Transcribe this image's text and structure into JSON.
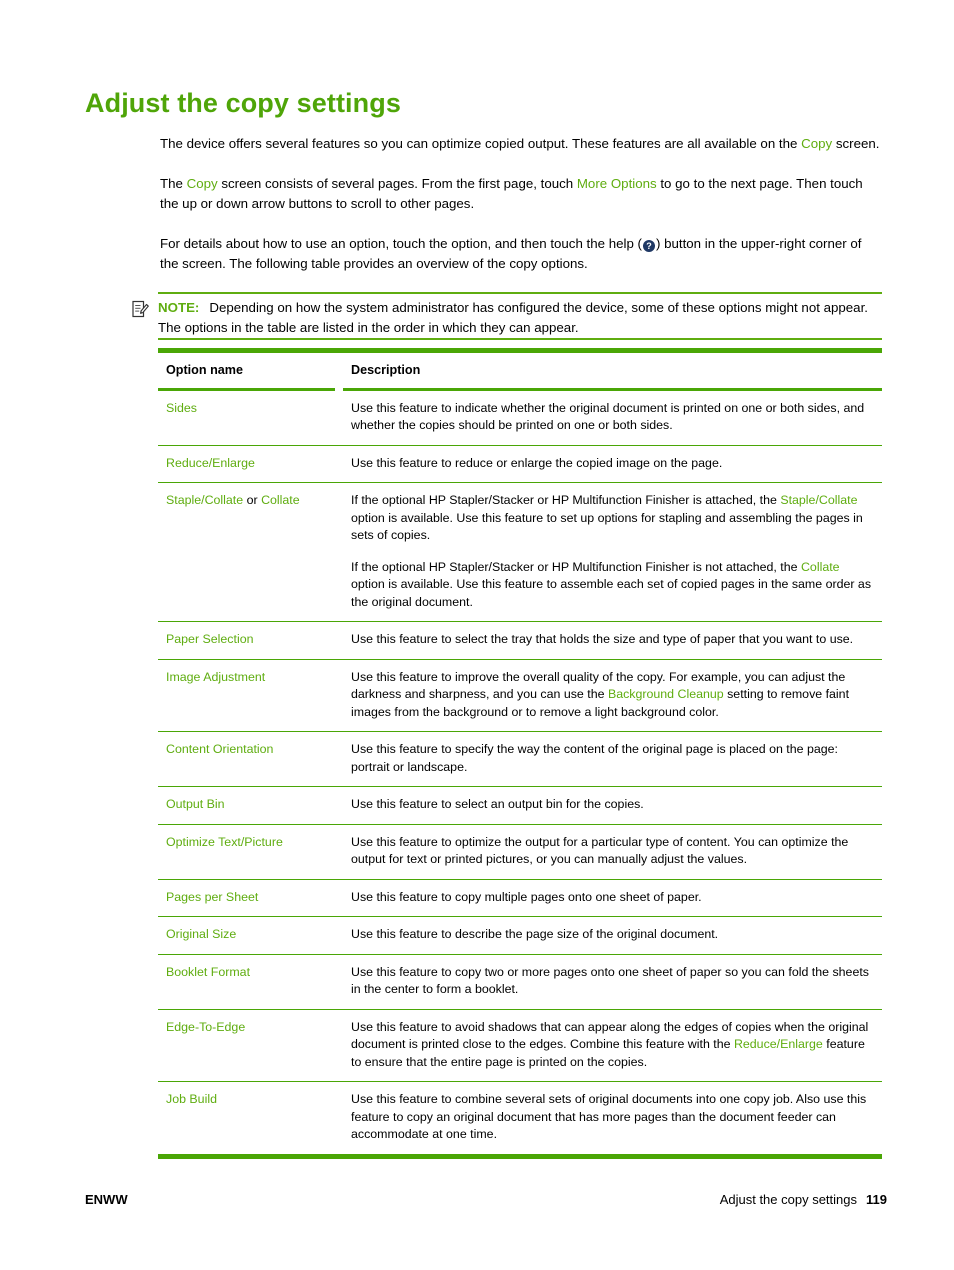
{
  "page": {
    "heading": "Adjust the copy settings",
    "accent_green": "#5FAD10",
    "rule_green": "#4AA606",
    "heading_green": "#4FA508",
    "help_icon_color": "#1F3864"
  },
  "intro": {
    "p1_a": "The device offers several features so you can optimize copied output. These features are all available on the ",
    "p1_link": "Copy",
    "p1_b": " screen.",
    "p2_a": "The ",
    "p2_link1": "Copy",
    "p2_b": " screen consists of several pages. From the first page, touch ",
    "p2_link2": "More Options",
    "p2_c": " to go to the next page. Then touch the up or down arrow buttons to scroll to other pages.",
    "p3_a": "For details about how to use an option, touch the option, and then touch the help (",
    "p3_icon": "?",
    "p3_b": ") button in the upper-right corner of the screen. The following table provides an overview of the copy options."
  },
  "note": {
    "label": "NOTE:",
    "text": "Depending on how the system administrator has configured the device, some of these options might not appear. The options in the table are listed in the order in which they can appear.",
    "icon": "note-pencil-icon"
  },
  "table": {
    "headers": {
      "col1": "Option name",
      "col2": "Description"
    },
    "rows": [
      {
        "name": "Sides",
        "name_parts": [
          {
            "t": "Sides",
            "link": true
          }
        ],
        "paragraphs": [
          [
            {
              "t": "Use this feature to indicate whether the original document is printed on one or both sides, and whether the copies should be printed on one or both sides.",
              "link": false
            }
          ]
        ]
      },
      {
        "name": "Reduce/Enlarge",
        "name_parts": [
          {
            "t": "Reduce/Enlarge",
            "link": true
          }
        ],
        "paragraphs": [
          [
            {
              "t": "Use this feature to reduce or enlarge the copied image on the page.",
              "link": false
            }
          ]
        ]
      },
      {
        "name": "Staple/Collate or Collate",
        "name_parts": [
          {
            "t": "Staple/Collate",
            "link": true
          },
          {
            "t": " or ",
            "link": false
          },
          {
            "t": "Collate",
            "link": true
          }
        ],
        "paragraphs": [
          [
            {
              "t": "If the optional HP Stapler/Stacker or HP Multifunction Finisher is attached, the ",
              "link": false
            },
            {
              "t": "Staple/Collate",
              "link": true
            },
            {
              "t": " option is available. Use this feature to set up options for stapling and assembling the pages in sets of copies.",
              "link": false
            }
          ],
          [
            {
              "t": "If the optional HP Stapler/Stacker or HP Multifunction Finisher is not attached, the ",
              "link": false
            },
            {
              "t": "Collate",
              "link": true
            },
            {
              "t": " option is available. Use this feature to assemble each set of copied pages in the same order as the original document.",
              "link": false
            }
          ]
        ]
      },
      {
        "name": "Paper Selection",
        "name_parts": [
          {
            "t": "Paper Selection",
            "link": true
          }
        ],
        "paragraphs": [
          [
            {
              "t": "Use this feature to select the tray that holds the size and type of paper that you want to use.",
              "link": false
            }
          ]
        ]
      },
      {
        "name": "Image Adjustment",
        "name_parts": [
          {
            "t": "Image Adjustment",
            "link": true
          }
        ],
        "paragraphs": [
          [
            {
              "t": "Use this feature to improve the overall quality of the copy. For example, you can adjust the darkness and sharpness, and you can use the ",
              "link": false
            },
            {
              "t": "Background Cleanup",
              "link": true
            },
            {
              "t": " setting to remove faint images from the background or to remove a light background color.",
              "link": false
            }
          ]
        ]
      },
      {
        "name": "Content Orientation",
        "name_parts": [
          {
            "t": "Content Orientation",
            "link": true
          }
        ],
        "paragraphs": [
          [
            {
              "t": "Use this feature to specify the way the content of the original page is placed on the page: portrait or landscape.",
              "link": false
            }
          ]
        ]
      },
      {
        "name": "Output Bin",
        "name_parts": [
          {
            "t": "Output Bin",
            "link": true
          }
        ],
        "paragraphs": [
          [
            {
              "t": "Use this feature to select an output bin for the copies.",
              "link": false
            }
          ]
        ]
      },
      {
        "name": "Optimize Text/Picture",
        "name_parts": [
          {
            "t": "Optimize Text/Picture",
            "link": true
          }
        ],
        "paragraphs": [
          [
            {
              "t": "Use this feature to optimize the output for a particular type of content. You can optimize the output for text or printed pictures, or you can manually adjust the values.",
              "link": false
            }
          ]
        ]
      },
      {
        "name": "Pages per Sheet",
        "name_parts": [
          {
            "t": "Pages per Sheet",
            "link": true
          }
        ],
        "paragraphs": [
          [
            {
              "t": "Use this feature to copy multiple pages onto one sheet of paper.",
              "link": false
            }
          ]
        ]
      },
      {
        "name": "Original Size",
        "name_parts": [
          {
            "t": "Original Size",
            "link": true
          }
        ],
        "paragraphs": [
          [
            {
              "t": "Use this feature to describe the page size of the original document.",
              "link": false
            }
          ]
        ]
      },
      {
        "name": "Booklet Format",
        "name_parts": [
          {
            "t": "Booklet Format",
            "link": true
          }
        ],
        "paragraphs": [
          [
            {
              "t": "Use this feature to copy two or more pages onto one sheet of paper so you can fold the sheets in the center to form a booklet.",
              "link": false
            }
          ]
        ]
      },
      {
        "name": "Edge-To-Edge",
        "name_parts": [
          {
            "t": "Edge-To-Edge",
            "link": true
          }
        ],
        "paragraphs": [
          [
            {
              "t": "Use this feature to avoid shadows that can appear along the edges of copies when the original document is printed close to the edges. Combine this feature with the ",
              "link": false
            },
            {
              "t": "Reduce/Enlarge",
              "link": true
            },
            {
              "t": " feature to ensure that the entire page is printed on the copies.",
              "link": false
            }
          ]
        ]
      },
      {
        "name": "Job Build",
        "name_parts": [
          {
            "t": "Job Build",
            "link": true
          }
        ],
        "paragraphs": [
          [
            {
              "t": "Use this feature to combine several sets of original documents into one copy job. Also use this feature to copy an original document that has more pages than the document feeder can accommodate at one time.",
              "link": false
            }
          ]
        ]
      }
    ]
  },
  "footer": {
    "left": "ENWW",
    "section": "Adjust the copy settings",
    "page_number": "119"
  }
}
